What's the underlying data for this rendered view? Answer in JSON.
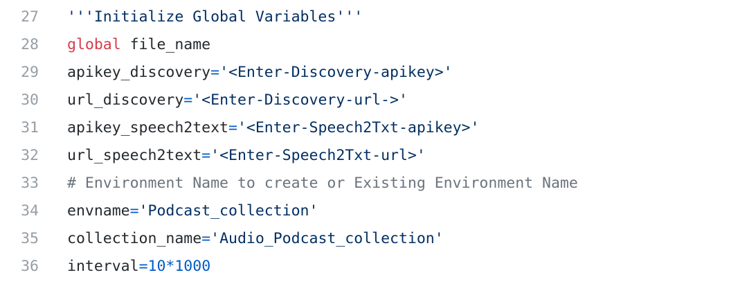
{
  "colors": {
    "background": "#ffffff",
    "line_number": "#959da5",
    "plain": "#24292e",
    "string": "#032f62",
    "keyword": "#d73a49",
    "operator": "#005cc5",
    "comment": "#6a737d"
  },
  "lines": [
    {
      "number": "27",
      "tokens": [
        {
          "type": "str",
          "text": "'''Initialize Global Variables'''"
        }
      ]
    },
    {
      "number": "28",
      "tokens": [
        {
          "type": "kw",
          "text": "global"
        },
        {
          "type": "plain",
          "text": " file_name"
        }
      ]
    },
    {
      "number": "29",
      "tokens": [
        {
          "type": "plain",
          "text": "apikey_discovery"
        },
        {
          "type": "op",
          "text": "="
        },
        {
          "type": "str",
          "text": "'<Enter-Discovery-apikey>'"
        }
      ]
    },
    {
      "number": "30",
      "tokens": [
        {
          "type": "plain",
          "text": "url_discovery"
        },
        {
          "type": "op",
          "text": "="
        },
        {
          "type": "str",
          "text": "'<Enter-Discovery-url->'"
        }
      ]
    },
    {
      "number": "31",
      "tokens": [
        {
          "type": "plain",
          "text": "apikey_speech2text"
        },
        {
          "type": "op",
          "text": "="
        },
        {
          "type": "str",
          "text": "'<Enter-Speech2Txt-apikey>'"
        }
      ]
    },
    {
      "number": "32",
      "tokens": [
        {
          "type": "plain",
          "text": "url_speech2text"
        },
        {
          "type": "op",
          "text": "="
        },
        {
          "type": "str",
          "text": "'<Enter-Speech2Txt-url>'"
        }
      ]
    },
    {
      "number": "33",
      "tokens": [
        {
          "type": "comment",
          "text": "# Environment Name to create or Existing Environment Name"
        }
      ]
    },
    {
      "number": "34",
      "tokens": [
        {
          "type": "plain",
          "text": "envname"
        },
        {
          "type": "op",
          "text": "="
        },
        {
          "type": "str",
          "text": "'Podcast_collection'"
        }
      ]
    },
    {
      "number": "35",
      "tokens": [
        {
          "type": "plain",
          "text": "collection_name"
        },
        {
          "type": "op",
          "text": "="
        },
        {
          "type": "str",
          "text": "'Audio_Podcast_collection'"
        }
      ]
    },
    {
      "number": "36",
      "tokens": [
        {
          "type": "plain",
          "text": "interval"
        },
        {
          "type": "op",
          "text": "="
        },
        {
          "type": "num",
          "text": "10"
        },
        {
          "type": "op",
          "text": "*"
        },
        {
          "type": "num",
          "text": "1000"
        }
      ]
    }
  ]
}
